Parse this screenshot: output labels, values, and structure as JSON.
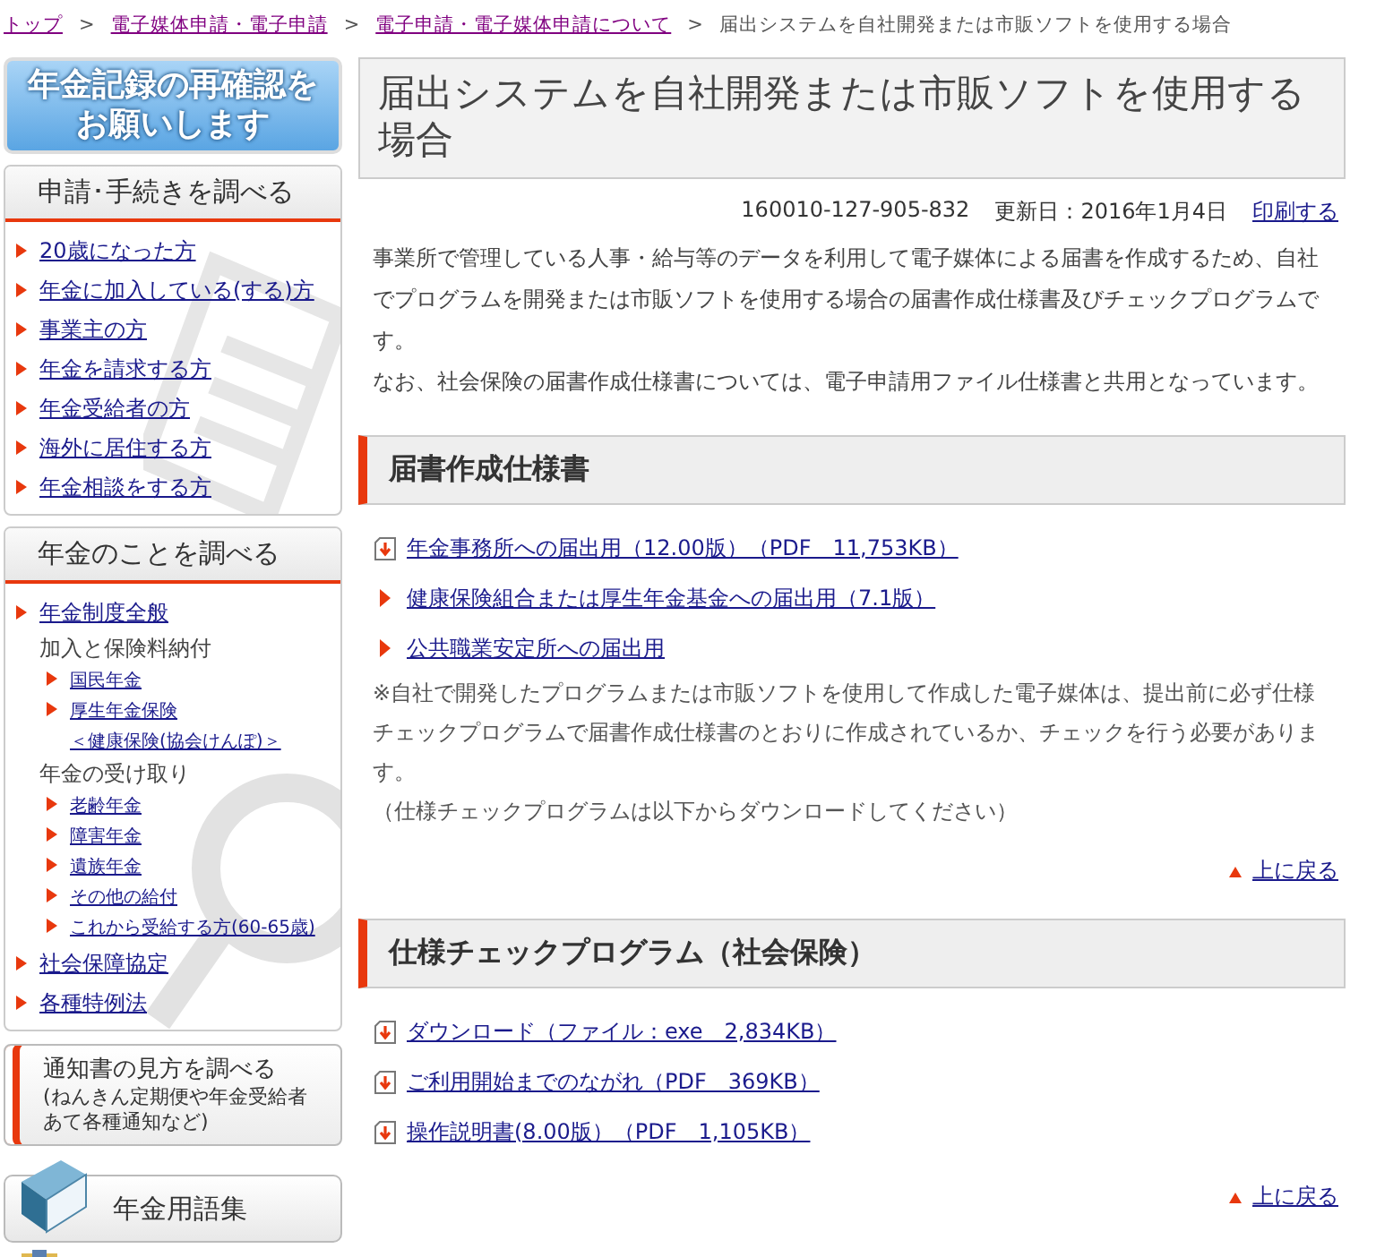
{
  "breadcrumb": [
    {
      "label": "トップ",
      "link": true
    },
    {
      "separator": ">",
      "label": "電子媒体申請・電子申請",
      "link": true
    },
    {
      "separator": ">",
      "label": "電子申請・電子媒体申請について",
      "link": true
    },
    {
      "separator": ">",
      "label": "届出システムを自社開発または市販ソフトを使用する場合",
      "link": false
    }
  ],
  "sidebar": {
    "banner": {
      "lines": [
        "年金記録の再確認を",
        "お願いします"
      ]
    },
    "panels": [
      {
        "title": "申請･手続きを調べる",
        "items": [
          {
            "label": "20歳になった方",
            "kind": "link"
          },
          {
            "label": "年金に加入している(する)方",
            "kind": "link"
          },
          {
            "label": "事業主の方",
            "kind": "link"
          },
          {
            "label": "年金を請求する方",
            "kind": "link"
          },
          {
            "label": "年金受給者の方",
            "kind": "link"
          },
          {
            "label": "海外に居住する方",
            "kind": "link"
          },
          {
            "label": "年金相談をする方",
            "kind": "link"
          }
        ]
      },
      {
        "title": "年金のことを調べる",
        "items": [
          {
            "label": "年金制度全般",
            "kind": "link"
          },
          {
            "label": "加入と保険料納付",
            "kind": "label",
            "children": [
              {
                "label": "国民年金",
                "kind": "link"
              },
              {
                "lines": [
                  "厚生年金保険",
                  "＜健康保険(協会けんぽ)＞"
                ],
                "kind": "link"
              }
            ]
          },
          {
            "label": "年金の受け取り",
            "kind": "label",
            "children": [
              {
                "label": "老齢年金",
                "kind": "link"
              },
              {
                "label": "障害年金",
                "kind": "link"
              },
              {
                "label": "遺族年金",
                "kind": "link"
              },
              {
                "label": "その他の給付",
                "kind": "link"
              },
              {
                "label": "これから受給する方(60-65歳)",
                "kind": "link"
              }
            ]
          },
          {
            "label": "社会保障協定",
            "kind": "link"
          },
          {
            "label": "各種特例法",
            "kind": "link"
          }
        ]
      }
    ],
    "notice": {
      "title": "通知書の見方を調べる",
      "sub": [
        "(ねんきん定期便や年金受給者",
        "あて各種通知など)"
      ]
    },
    "glossary": {
      "label": "年金用語集"
    }
  },
  "main": {
    "title": "届出システムを自社開発または市販ソフトを使用する場合",
    "meta": {
      "id": "160010-127-905-832",
      "updated": "更新日：2016年1月4日",
      "print": "印刷する"
    },
    "intro": [
      "事業所で管理している人事・給与等のデータを利用して電子媒体による届書を作成するため、自社でプログラムを開発または市販ソフトを使用する場合の届書作成仕様書及びチェックプログラムです。",
      "なお、社会保険の届書作成仕様書については、電子申請用ファイル仕様書と共用となっています。"
    ],
    "sections": [
      {
        "heading": "届書作成仕様書",
        "links": [
          {
            "label": "年金事務所への届出用（12.00版）（PDF　11,753KB）",
            "kind": "download"
          },
          {
            "label": "健康保険組合または厚生年金基金への届出用（7.1版）",
            "kind": "page"
          },
          {
            "label": "公共職業安定所への届出用",
            "kind": "page"
          }
        ],
        "notes": [
          "※自社で開発したプログラムまたは市販ソフトを使用して作成した電子媒体は、提出前に必ず仕様チェックプログラムで届書作成仕様書のとおりに作成されているか、チェックを行う必要があります。",
          "（仕様チェックプログラムは以下からダウンロードしてください）"
        ],
        "back": "上に戻る"
      },
      {
        "heading": "仕様チェックプログラム（社会保険）",
        "links": [
          {
            "label": "ダウンロード（ファイル：exe　2,834KB）",
            "kind": "download"
          },
          {
            "label": "ご利用開始までのながれ（PDF　369KB）",
            "kind": "download"
          },
          {
            "label": "操作説明書(8.00版）（PDF　1,105KB）",
            "kind": "download"
          }
        ],
        "back": "上に戻る"
      }
    ]
  }
}
